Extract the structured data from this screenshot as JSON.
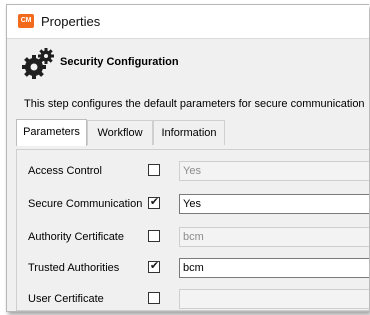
{
  "window": {
    "title": "Properties",
    "app_icon_text": "CM"
  },
  "header": {
    "section_title": "Security Configuration",
    "description": "This step configures the default parameters for secure communication"
  },
  "tabs": [
    {
      "label": "Parameters",
      "active": true
    },
    {
      "label": "Workflow",
      "active": false
    },
    {
      "label": "Information",
      "active": false
    }
  ],
  "fields": [
    {
      "label": "Access Control",
      "checked": false,
      "value": "Yes",
      "enabled": false
    },
    {
      "label": "Secure Communication",
      "checked": true,
      "value": "Yes",
      "enabled": true
    },
    {
      "label": "Authority Certificate",
      "checked": false,
      "value": "bcm",
      "enabled": false
    },
    {
      "label": "Trusted Authorities",
      "checked": true,
      "value": "bcm",
      "enabled": true
    },
    {
      "label": "User Certificate",
      "checked": false,
      "value": "",
      "enabled": false
    }
  ],
  "colors": {
    "app_icon": "#f26a1b",
    "window_bg": "#f0f0f0"
  }
}
